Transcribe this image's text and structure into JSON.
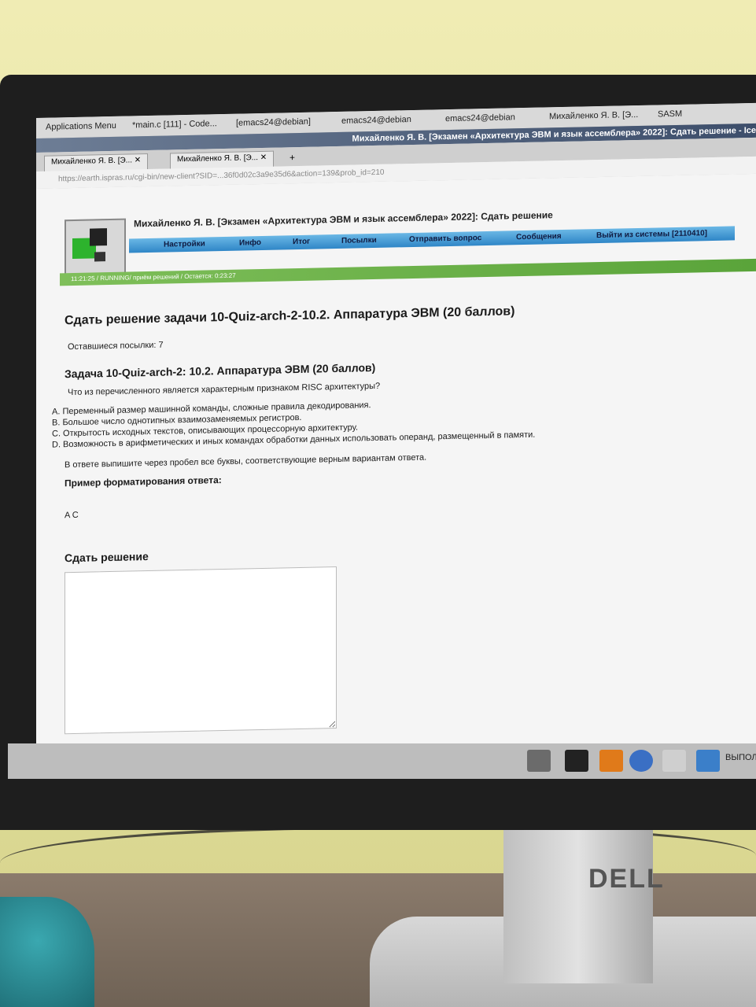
{
  "wm_bar": {
    "apps_menu": "Applications Menu",
    "windows": [
      "*main.c [111] - Code...",
      "[emacs24@debian]",
      "emacs24@debian",
      "emacs24@debian",
      "Михайленко Я. В. [Э...",
      "SASM"
    ]
  },
  "window_title": "Михайленко Я. В. [Экзамен «Архитектура ЭВМ и язык ассемблера» 2022]: Сдать решение - Ice",
  "tabs": [
    "Михайленко Я. В. [Э...",
    "Михайленко Я. В. [Э..."
  ],
  "url": "https://earth.ispras.ru/cgi-bin/new-client?SID=...36f0d02c3a9e35d6&action=139&prob_id=210",
  "header": {
    "title": "Михайленко Я. В. [Экзамен «Архитектура ЭВМ и язык ассемблера» 2022]: Сдать решение",
    "menu": [
      "Настройки",
      "Инфо",
      "Итог",
      "Посылки",
      "Отправить вопрос",
      "Сообщения",
      "Выйти из системы [2110410]"
    ]
  },
  "status": "11:21:25 / RUNNING/ приём решений / Остается: 0:23:27",
  "content": {
    "heading": "Сдать решение задачи 10-Quiz-arch-2-10.2. Аппаратура ЭВМ (20 баллов)",
    "remaining": "Оставшиеся посылки:  7",
    "task_heading": "Задача 10-Quiz-arch-2: 10.2. Аппаратура ЭВМ (20 баллов)",
    "question": "Что из перечисленного является характерным признаком RISC архитектуры?",
    "options": [
      "A. Переменный размер машинной команды, сложные правила декодирования.",
      "B. Большое число однотипных взаимозаменяемых регистров.",
      "C. Открытость исходных текстов, описывающих процессорную архитектуру.",
      "D. Возможность в арифметических и иных командах обработки данных использовать операнд, размещенный в памяти."
    ],
    "instruction": "В ответе выпишите через пробел все буквы, соответствующие верным вариантам ответа.",
    "example_heading": "Пример форматирования ответа:",
    "example": "A C",
    "submit_heading": "Сдать решение"
  },
  "taskbar_right": "ВЫПОЛ",
  "monitor_brand": "DELL"
}
